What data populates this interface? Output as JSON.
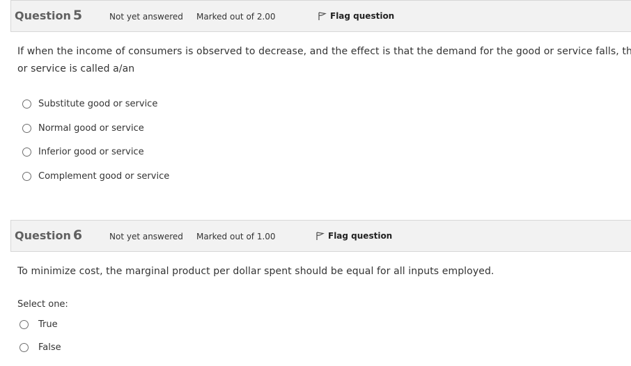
{
  "q5": {
    "label": "Question",
    "number": "5",
    "state": "Not yet answered",
    "grade": "Marked out of 2.00",
    "flag": "Flag question",
    "text_line1": "If when the income of consumers is observed to decrease, and the effect is that the demand for the good or service falls, the",
    "text_line2": "or service is called a/an",
    "options": [
      "Substitute good or service",
      "Normal good or service",
      "Inferior good or service",
      "Complement good or service"
    ]
  },
  "q6": {
    "label": "Question",
    "number": "6",
    "state": "Not yet answered",
    "grade": "Marked out of 1.00",
    "flag": "Flag question",
    "text": "To minimize cost, the marginal product per dollar spent should be equal for all inputs employed.",
    "prompt": "Select one:",
    "options": [
      "True",
      "False"
    ]
  },
  "icons": {
    "flag": "flag-icon",
    "radio": "radio-button"
  },
  "colors": {
    "header_bg": "#f2f2f2",
    "header_border": "#d7d7d7",
    "title_gray": "#606060",
    "text": "#333333"
  }
}
